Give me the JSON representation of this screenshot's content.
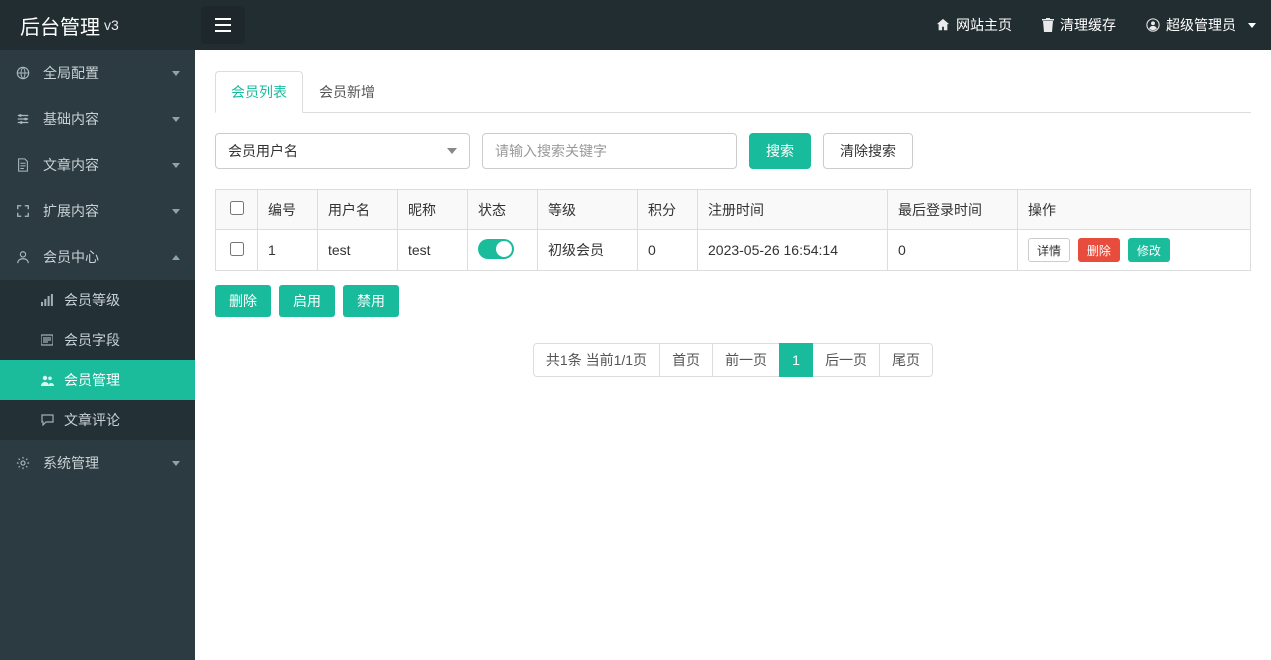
{
  "brand": {
    "title": "后台管理",
    "version": "v3"
  },
  "navbar": {
    "home": "网站主页",
    "clear_cache": "清理缓存",
    "user": "超级管理员"
  },
  "sidebar": {
    "items": [
      {
        "label": "全局配置"
      },
      {
        "label": "基础内容"
      },
      {
        "label": "文章内容"
      },
      {
        "label": "扩展内容"
      },
      {
        "label": "会员中心"
      },
      {
        "label": "系统管理"
      }
    ],
    "member_children": [
      {
        "label": "会员等级"
      },
      {
        "label": "会员字段"
      },
      {
        "label": "会员管理"
      },
      {
        "label": "文章评论"
      }
    ]
  },
  "tabs": {
    "list": "会员列表",
    "add": "会员新增"
  },
  "search": {
    "field_label": "会员用户名",
    "placeholder": "请输入搜索关键字",
    "search_btn": "搜索",
    "clear_btn": "清除搜索"
  },
  "table": {
    "headers": {
      "id": "编号",
      "username": "用户名",
      "nickname": "昵称",
      "status": "状态",
      "level": "等级",
      "score": "积分",
      "reg_time": "注册时间",
      "last_login": "最后登录时间",
      "action": "操作"
    },
    "rows": [
      {
        "id": "1",
        "username": "test",
        "nickname": "test",
        "status_on": true,
        "level": "初级会员",
        "score": "0",
        "reg_time": "2023-05-26 16:54:14",
        "last_login": "0"
      }
    ],
    "row_actions": {
      "detail": "详情",
      "delete": "删除",
      "edit": "修改"
    }
  },
  "batch": {
    "delete": "删除",
    "enable": "启用",
    "disable": "禁用"
  },
  "pagination": {
    "info": "共1条 当前1/1页",
    "first": "首页",
    "prev": "前一页",
    "current": "1",
    "next": "后一页",
    "last": "尾页"
  }
}
